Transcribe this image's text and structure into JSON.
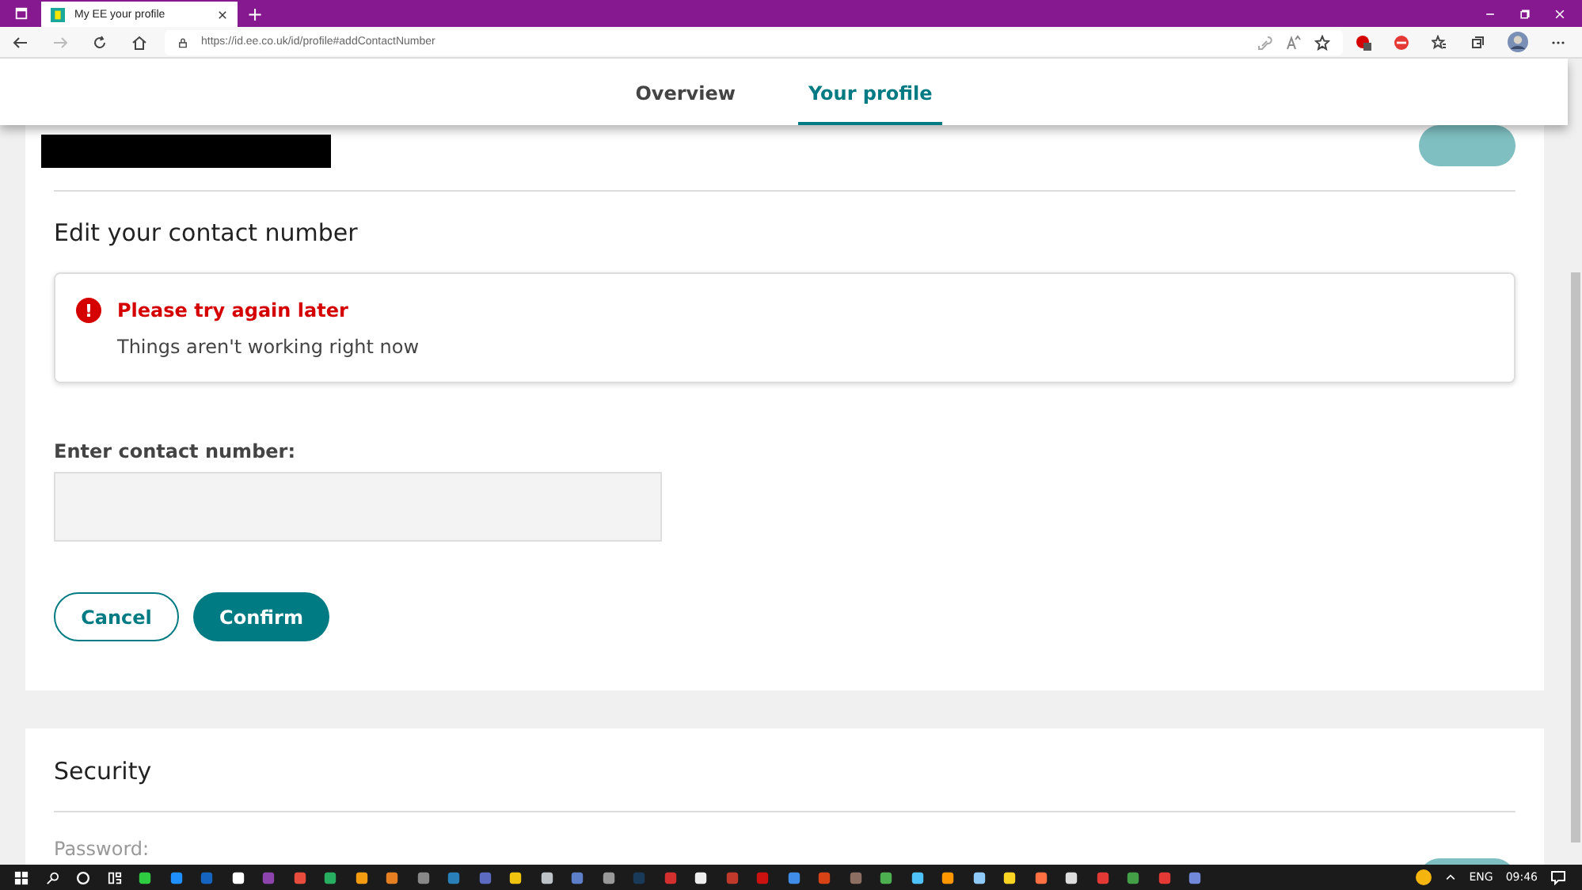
{
  "browser": {
    "tab_title": "My EE your profile",
    "new_tab": "+",
    "url": "https://id.ee.co.uk/id/profile#addContactNumber"
  },
  "nav": {
    "tabs": [
      {
        "label": "Overview",
        "selected": false
      },
      {
        "label": "Your profile",
        "selected": true
      }
    ]
  },
  "contact_card": {
    "heading": "Edit your contact number",
    "alert": {
      "icon": "!",
      "title": "Please try again later",
      "message": "Things aren't working right now"
    },
    "field": {
      "label": "Enter contact number:"
    },
    "cancel_button": "Cancel",
    "confirm_button": "Confirm"
  },
  "security_card": {
    "heading": "Security",
    "field_label": "Password:"
  },
  "taskbar": {
    "language": "ENG",
    "time": "09:46"
  }
}
